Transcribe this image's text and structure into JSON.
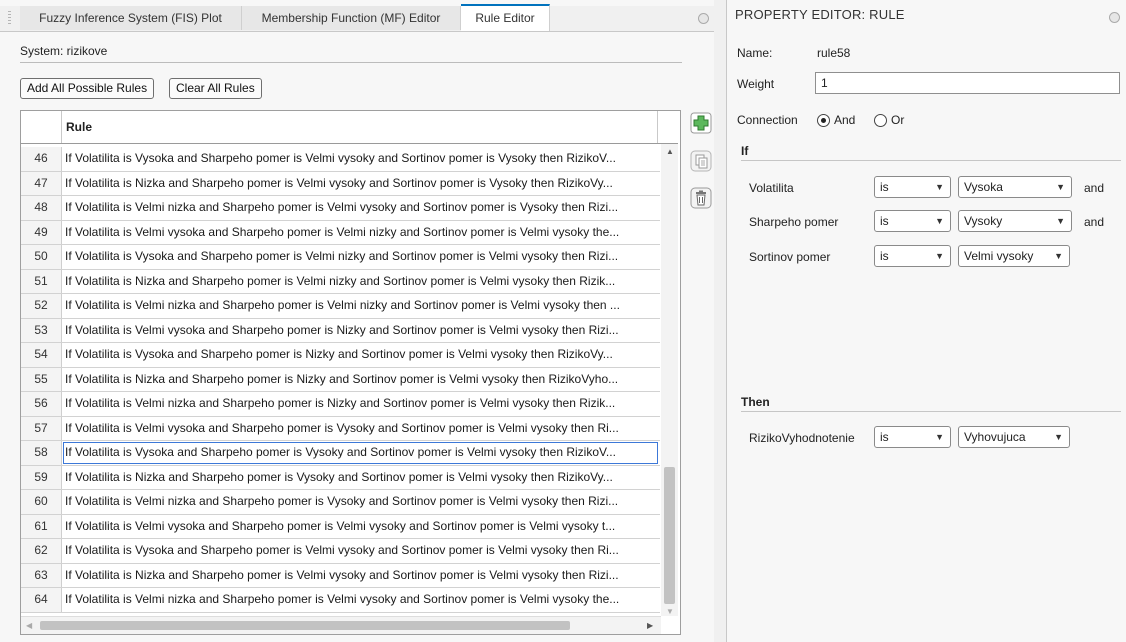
{
  "tabs": [
    {
      "label": "Fuzzy Inference System (FIS) Plot",
      "active": false
    },
    {
      "label": "Membership Function (MF) Editor",
      "active": false
    },
    {
      "label": "Rule Editor",
      "active": true
    }
  ],
  "system_label": "System: rizikove",
  "buttons": {
    "add_all": "Add All Possible Rules",
    "clear_all": "Clear All Rules"
  },
  "table": {
    "column_header": "Rule",
    "rows": [
      {
        "num": "46",
        "text": "If Volatilita is Vysoka and Sharpeho pomer is Velmi vysoky and Sortinov pomer is Vysoky then RizikoV..."
      },
      {
        "num": "47",
        "text": "If Volatilita is Nizka and Sharpeho pomer is Velmi vysoky and Sortinov pomer is Vysoky then RizikoVy..."
      },
      {
        "num": "48",
        "text": "If Volatilita is Velmi nizka and Sharpeho pomer is Velmi vysoky and Sortinov pomer is Vysoky then Rizi..."
      },
      {
        "num": "49",
        "text": "If Volatilita is Velmi vysoka and Sharpeho pomer is Velmi nizky and Sortinov pomer is Velmi vysoky the..."
      },
      {
        "num": "50",
        "text": "If Volatilita is Vysoka and Sharpeho pomer is Velmi nizky and Sortinov pomer is Velmi vysoky then Rizi..."
      },
      {
        "num": "51",
        "text": "If Volatilita is Nizka and Sharpeho pomer is Velmi nizky and Sortinov pomer is Velmi vysoky then Rizik..."
      },
      {
        "num": "52",
        "text": "If Volatilita is Velmi nizka and Sharpeho pomer is Velmi nizky and Sortinov pomer is Velmi vysoky then ..."
      },
      {
        "num": "53",
        "text": "If Volatilita is Velmi vysoka and Sharpeho pomer is Nizky and Sortinov pomer is Velmi vysoky then Rizi..."
      },
      {
        "num": "54",
        "text": "If Volatilita is Vysoka and Sharpeho pomer is Nizky and Sortinov pomer is Velmi vysoky then RizikoVy..."
      },
      {
        "num": "55",
        "text": "If Volatilita is Nizka and Sharpeho pomer is Nizky and Sortinov pomer is Velmi vysoky then RizikoVyho..."
      },
      {
        "num": "56",
        "text": "If Volatilita is Velmi nizka and Sharpeho pomer is Nizky and Sortinov pomer is Velmi vysoky then Rizik..."
      },
      {
        "num": "57",
        "text": "If Volatilita is Velmi vysoka and Sharpeho pomer is Vysoky and Sortinov pomer is Velmi vysoky then Ri..."
      },
      {
        "num": "58",
        "text": "If Volatilita is Vysoka and Sharpeho pomer is Vysoky and Sortinov pomer is Velmi vysoky then RizikoV...",
        "selected": true
      },
      {
        "num": "59",
        "text": "If Volatilita is Nizka and Sharpeho pomer is Vysoky and Sortinov pomer is Velmi vysoky then RizikoVy..."
      },
      {
        "num": "60",
        "text": "If Volatilita is Velmi nizka and Sharpeho pomer is Vysoky and Sortinov pomer is Velmi vysoky then Rizi..."
      },
      {
        "num": "61",
        "text": "If Volatilita is Velmi vysoka and Sharpeho pomer is Velmi vysoky and Sortinov pomer is Velmi vysoky t..."
      },
      {
        "num": "62",
        "text": "If Volatilita is Vysoka and Sharpeho pomer is Velmi vysoky and Sortinov pomer is Velmi vysoky then Ri..."
      },
      {
        "num": "63",
        "text": "If Volatilita is Nizka and Sharpeho pomer is Velmi vysoky and Sortinov pomer is Velmi vysoky then Rizi..."
      },
      {
        "num": "64",
        "text": "If Volatilita is Velmi nizka and Sharpeho pomer is Velmi vysoky and Sortinov pomer is Velmi vysoky the..."
      }
    ]
  },
  "side_icons": [
    "add-rule-icon",
    "copy-rule-icon",
    "delete-rule-icon"
  ],
  "property_editor": {
    "title": "PROPERTY EDITOR: RULE",
    "name_label": "Name:",
    "name_value": "rule58",
    "weight_label": "Weight",
    "weight_value": "1",
    "connection_label": "Connection",
    "connection_and": "And",
    "connection_or": "Or",
    "connection_selected": "And",
    "if_header": "If",
    "then_header": "Then",
    "antecedents": [
      {
        "variable": "Volatilita",
        "op": "is",
        "term": "Vysoka",
        "conj": "and"
      },
      {
        "variable": "Sharpeho pomer",
        "op": "is",
        "term": "Vysoky",
        "conj": "and"
      },
      {
        "variable": "Sortinov pomer",
        "op": "is",
        "term": "Velmi vysoky",
        "conj": ""
      }
    ],
    "consequent": {
      "variable": "RizikoVyhodnotenie",
      "op": "is",
      "term": "Vyhovujuca"
    }
  },
  "colors": {
    "accent": "#0072bd",
    "add_icon": "#4cae4c",
    "selection": "#3c78d8"
  }
}
